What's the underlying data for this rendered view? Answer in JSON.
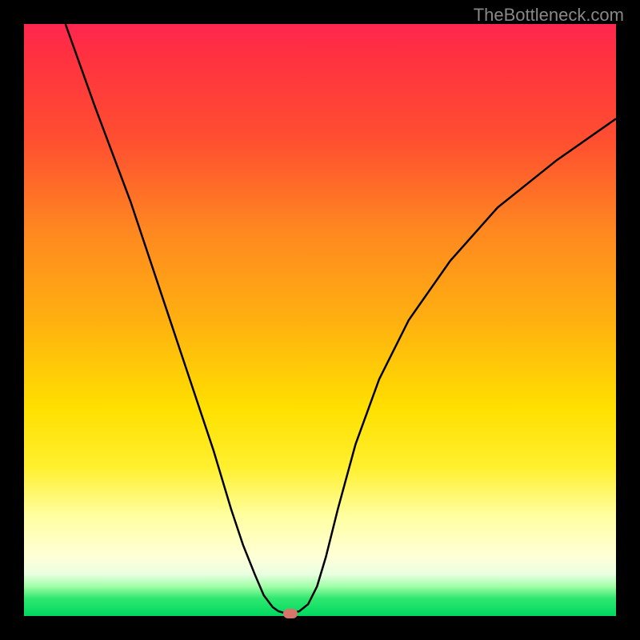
{
  "watermark": "TheBottleneck.com",
  "chart_data": {
    "type": "line",
    "title": "",
    "xlabel": "",
    "ylabel": "",
    "xlim": [
      0,
      100
    ],
    "ylim": [
      0,
      100
    ],
    "background_gradient": {
      "top": "#ff2650",
      "middle": "#ffe000",
      "bottom": "#00d860"
    },
    "series": [
      {
        "name": "bottleneck-curve",
        "color": "#000000",
        "x": [
          7,
          12,
          18,
          24,
          28,
          32,
          35,
          37,
          39,
          40.5,
          42,
          43,
          44,
          45,
          46.5,
          48,
          49.5,
          51,
          53,
          56,
          60,
          65,
          72,
          80,
          90,
          100
        ],
        "y": [
          100,
          86,
          70,
          52,
          40,
          28,
          18,
          12,
          7,
          3.5,
          1.5,
          0.8,
          0.5,
          0.5,
          0.8,
          2,
          5,
          10,
          18,
          29,
          40,
          50,
          60,
          69,
          77,
          84
        ]
      }
    ],
    "marker": {
      "x": 45,
      "y": 0.4,
      "color": "#d8756a"
    }
  }
}
